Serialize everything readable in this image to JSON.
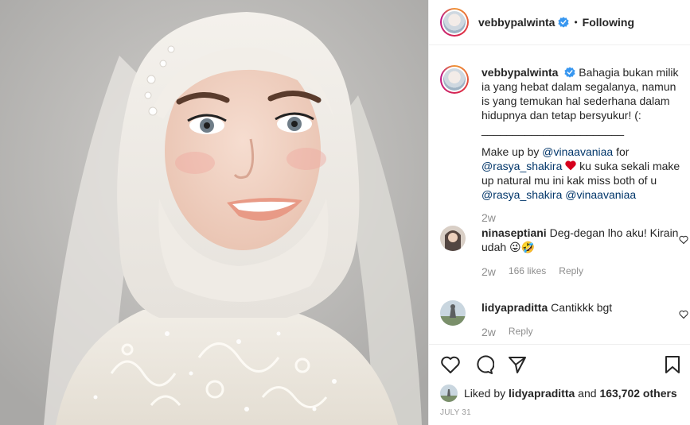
{
  "header": {
    "username": "vebbypalwinta",
    "separator": "•",
    "follow_status": "Following"
  },
  "caption": {
    "username": "vebbypalwinta",
    "line1": "Bahagia bukan milik ia yang hebat dalam segalanya, namun is yang temukan hal sederhana dalam hidupnya dan tetap bersyukur! (:",
    "divider": "_______________________",
    "line2_pre": "Make up by ",
    "mention1": "@vinaavaniaa",
    "line2_mid": " for ",
    "mention2": "@rasya_shakira",
    "line2_post": " ku suka sekali make up natural mu ini kak miss both of u ",
    "mention3": "@rasya_shakira",
    "mention4": "@vinaavaniaa",
    "time": "2w"
  },
  "comments": [
    {
      "username": "ninaseptiani",
      "text": "Deg-degan lho aku! Kirain udah 😜🤣",
      "time": "2w",
      "likes": "166 likes",
      "reply": "Reply"
    },
    {
      "username": "lidyapraditta",
      "text": "Cantikkk bgt",
      "time": "2w",
      "reply": "Reply"
    }
  ],
  "likes": {
    "prefix": "Liked by ",
    "user": "lidyapraditta",
    "middle": " and ",
    "others": "163,702 others"
  },
  "date": "JULY 31",
  "colors": {
    "mention": "#003569",
    "verified": "#3897f0",
    "muted": "#8e8e8e"
  },
  "icons": [
    "heart-icon",
    "comment-icon",
    "share-icon",
    "bookmark-icon",
    "verified-badge-icon"
  ]
}
